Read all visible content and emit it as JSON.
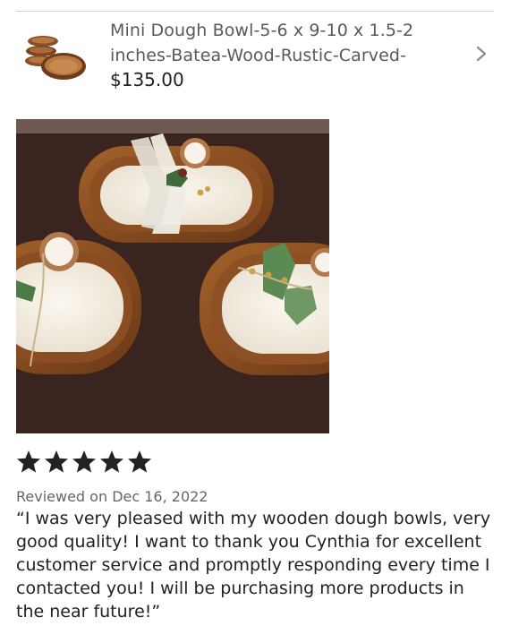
{
  "listing": {
    "title": "Mini Dough Bowl-5-6 x 9-10 x 1.5-2 inches-Batea-Wood-Rustic-Carved-",
    "price": "$135.00",
    "thumbnail_icon": "wooden-bowls-thumbnail",
    "open_icon": "chevron-right-icon"
  },
  "review": {
    "rating": 5,
    "rating_max": 5,
    "star_color": "#222222",
    "date": "Reviewed on Dec 16, 2022",
    "text": "“I was very pleased with my wooden dough bowls, very good quality! I want to thank you Cynthia for excellent customer service and promptly responding every time I contacted you! I will be purchasing more products in the near future!”"
  }
}
